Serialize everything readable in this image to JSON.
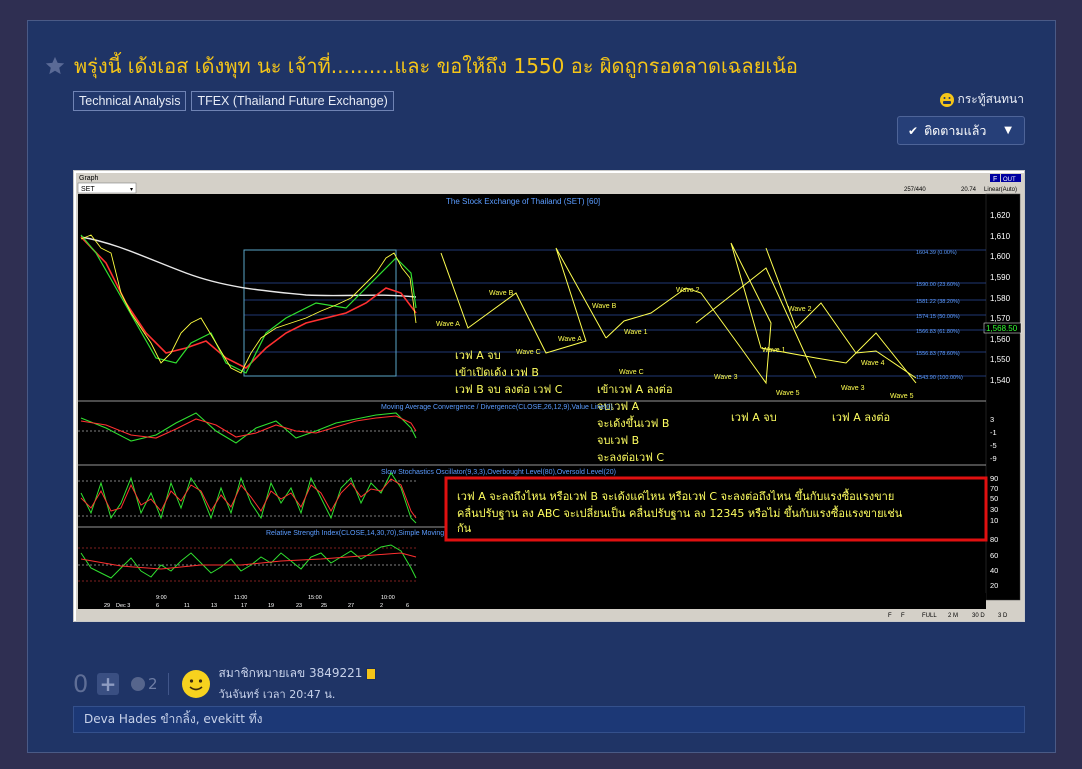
{
  "topic": {
    "title": "พรุ่งนี้ เด้งเอส เด้งพุท นะ เจ้าที่..........และ ขอให้ถึง 1550 อะ ผิดถูกรอตลาดเฉลยเน้อ",
    "tags": [
      "Technical Analysis",
      "TFEX (Thailand Future Exchange)"
    ],
    "type_label": "กระทู้สนทนา",
    "follow_label": "ติดตามแล้ว",
    "colors": {
      "title": "#f5c518",
      "background": "#1f3466"
    }
  },
  "chart": {
    "window_label": "Graph",
    "symbol_select": "SET",
    "bar_info": "257/440",
    "scale_value": "20.74",
    "scale_mode": "Linear(Auto)",
    "buttons": [
      "F",
      "OUT"
    ],
    "main_title": "The Stock Exchange of Thailand (SET) [60]",
    "price_tag": "1,568.50",
    "price_axis": [
      "1,620",
      "1,610",
      "1,600",
      "1,590",
      "1,580",
      "1,570",
      "1,560",
      "1,550",
      "1,540"
    ],
    "fib_levels": [
      "1604.39 (0.00%)",
      "1590.00 (23.60%)",
      "1581.22 (38.20%)",
      "1574.15 (50.00%)",
      "1566.83 (61.80%)",
      "1556.83 (78.60%)",
      "1543.90 (100.00%)"
    ],
    "wave_labels": [
      "Wave A",
      "Wave B",
      "Wave C",
      "Wave A",
      "Wave B",
      "Wave C",
      "Wave 1",
      "Wave 2",
      "Wave 3",
      "Wave 1",
      "Wave 5",
      "Wave 2",
      "Wave 3",
      "Wave 4",
      "Wave 5"
    ],
    "notes": {
      "note1": [
        "เวฟ A จบ",
        "เข้าเปิดเด้ง เวฟ B",
        "เวฟ B จบ ลงต่อ เวฟ C"
      ],
      "note2": [
        "เข้าเวฟ A ลงต่อ",
        "จบเวฟ A",
        "จะเด้งขึ้นเวฟ B",
        "จบเวฟ B",
        "จะลงต่อเวฟ C"
      ],
      "note3": "เวฟ A จบ",
      "note4": "เวฟ A ลงต่อ",
      "boxed": [
        "เวฟ A จะลงถึงไหน หรือเวฟ B จะเด้งแค่ไหน หรือเวฟ C จะลงต่อถึงไหน ขึ้นกับแรงซื้อแรงขาย",
        "คลื่นปรับฐาน ลง ABC จะเปลี่ยนเป็น คลื่นปรับฐาน ลง 12345 หรือไม่ ขึ้นกับแรงซื้อแรงขายเช่น",
        "กัน"
      ]
    },
    "macd_title": "Moving Average Convergence / Divergence(CLOSE,26,12,9),Value Line(0)",
    "macd_axis": [
      "3",
      "-1",
      "-5",
      "-9"
    ],
    "stoch_title": "Slow Stochastics Oscillator(9,3,3),Overbought Level(80),Oversold Level(20)",
    "stoch_axis": [
      "90",
      "70",
      "50",
      "30",
      "10"
    ],
    "rsi_title": "Relative Strength Index(CLOSE,14,30,70),Simple Moving Average(RSI,14,0),Overbought Level(70),Oversold Level(30),Value Line(50)",
    "rsi_axis": [
      "80",
      "60",
      "40",
      "20"
    ],
    "time_top": [
      "9:00",
      "11:00",
      "15:00",
      "10:00"
    ],
    "time_bottom": [
      "29",
      "Dec 3",
      "6",
      "11",
      "13",
      "17",
      "19",
      "23",
      "25",
      "27",
      "2",
      "6"
    ],
    "bottom_buttons": [
      "F",
      "F",
      "FULL",
      "2 M",
      "30 D",
      "3 D"
    ]
  },
  "post": {
    "vote_count": "0",
    "emotion_count": "2",
    "member": "สมาชิกหมายเลข 3849221",
    "time": "วันจันทร์ เวลา 20:47 น.",
    "reactions": "Deva Hades ขำกลิ้ง, evekitt ทึ่ง"
  }
}
